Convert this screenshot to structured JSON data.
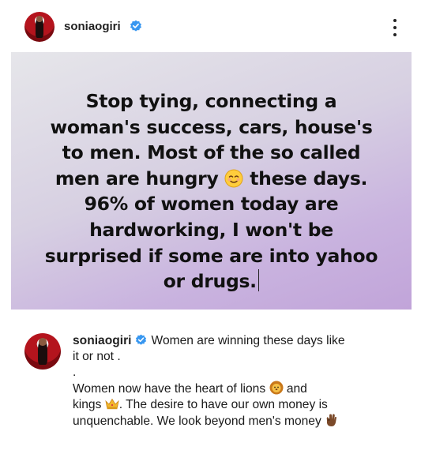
{
  "post": {
    "username": "soniaogiri",
    "more_options_icon": "vertical-ellipsis-icon",
    "verified_icon": "verified-badge-icon",
    "accent_color": "#3897f0"
  },
  "image_text": {
    "line1": "Stop tying, connecting a",
    "line2": "woman's success, cars, house's",
    "line3": "to men. Most of the so called",
    "line4a": "men are hungry ",
    "line4_emoji": "relieved-face-emoji",
    "line4b": " these days.",
    "line5": "96% of women today are",
    "line6": "hardworking, I won't be",
    "line7": "surprised if some are into yahoo",
    "line8": "or drugs."
  },
  "caption": {
    "username": "soniaogiri",
    "line1": "Women are winning these days like",
    "line2": "it or not .",
    "line3": ".",
    "line4a": "Women now have the heart of lions ",
    "line4_emoji": "lion-face-emoji",
    "line4b": " and",
    "line5a": "kings ",
    "line5_emoji": "crown-emoji",
    "line5b": ". The desire to have our own money is",
    "line6a": "unquenchable. We look beyond men's money ",
    "line6_emoji": "ok-hand-emoji"
  }
}
